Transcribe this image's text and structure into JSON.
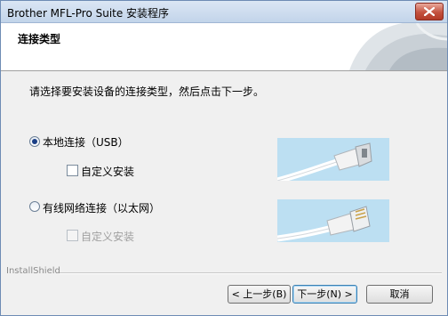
{
  "window": {
    "title": "Brother MFL-Pro Suite 安装程序"
  },
  "header": {
    "title": "连接类型"
  },
  "instruction": "请选择要安装设备的连接类型，然后点击下一步。",
  "options": [
    {
      "label": "本地连接（USB）",
      "selected": true,
      "custom_install_label": "自定义安装",
      "custom_install_enabled": true,
      "custom_install_checked": false,
      "image": "usb-cable-image"
    },
    {
      "label": "有线网络连接（以太网）",
      "selected": false,
      "custom_install_label": "自定义安装",
      "custom_install_enabled": false,
      "custom_install_checked": false,
      "image": "ethernet-cable-image"
    }
  ],
  "footer": {
    "brand": "InstallShield"
  },
  "buttons": {
    "back": "< 上一步(B)",
    "next": "下一步(N) >",
    "cancel": "取消"
  },
  "colors": {
    "title_bar": "#c9d9ee",
    "close_button": "#c4523f",
    "image_background": "#bcdff2"
  }
}
